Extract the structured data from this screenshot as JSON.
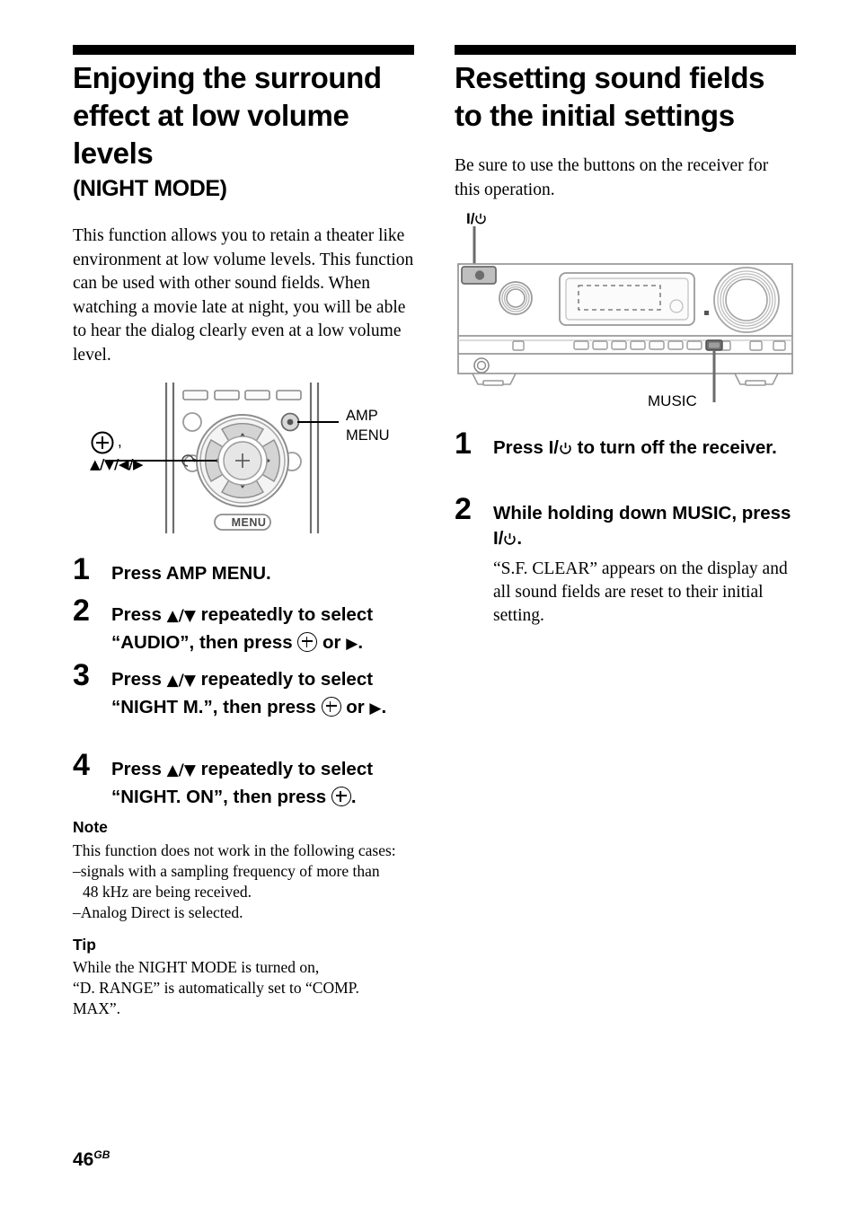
{
  "page": {
    "folio_number": "46",
    "folio_region": "GB"
  },
  "left_column": {
    "heading_main": "Enjoying the surround effect at low volume levels",
    "heading_sub": "(NIGHT MODE)",
    "intro": "This function allows you to retain a theater like environment at low volume levels. This function can be used with other sound fields. When watching a movie late at night, you will be able to hear the dialog clearly even at a low volume level.",
    "figure": {
      "name": "remote-control-diagram",
      "callout_enter": ",",
      "callout_arrows": "/ / /",
      "callout_amp_menu_line1": "AMP",
      "callout_amp_menu_line2": "MENU",
      "menu_button_label": "MENU"
    },
    "steps": [
      {
        "number": "1",
        "text_parts": [
          "Press AMP MENU."
        ]
      },
      {
        "number": "2",
        "text_before": "Press",
        "text_mid": "repeatedly to select “AUDIO”, then press",
        "text_after": "or"
      },
      {
        "number": "3",
        "text_before": "Press",
        "text_mid": "repeatedly to select “NIGHT M.”, then press",
        "text_after": "or"
      },
      {
        "number": "4",
        "text_before": "Press",
        "text_mid": "repeatedly to select “NIGHT. ON”, then press",
        "text_after": "."
      }
    ],
    "note": {
      "title": "Note",
      "line1": "This function does not work in the following cases:",
      "line2": "–signals with a sampling frequency of more than",
      "line3": "48 kHz are being received.",
      "line4": "–Analog Direct is selected."
    },
    "tip": {
      "title": "Tip",
      "line1": "While the NIGHT MODE is turned on,",
      "line2": "“D. RANGE” is automatically set to “COMP.",
      "line3": "MAX”."
    }
  },
  "right_column": {
    "heading_main": "Resetting sound fields to the initial settings",
    "intro": "Be sure to use the buttons on the receiver for this operation.",
    "figure": {
      "name": "receiver-front-panel-diagram",
      "callout_power": "I/",
      "callout_music": "MUSIC"
    },
    "steps": [
      {
        "number": "1",
        "text_before": "Press",
        "text_after": "to turn off the receiver."
      },
      {
        "number": "2",
        "text_before": "While holding down MUSIC, press",
        "text_after": ".",
        "description": "“S.F. CLEAR” appears on the display and all sound fields are reset to their initial setting."
      }
    ]
  },
  "colors": {
    "ink": "#000000",
    "paper": "#ffffff",
    "diagram_line": "#6b6b6b",
    "diagram_fill_light": "#f2f2f2",
    "diagram_fill_gray": "#c9c9c9",
    "diagram_fill_dark": "#777777"
  }
}
